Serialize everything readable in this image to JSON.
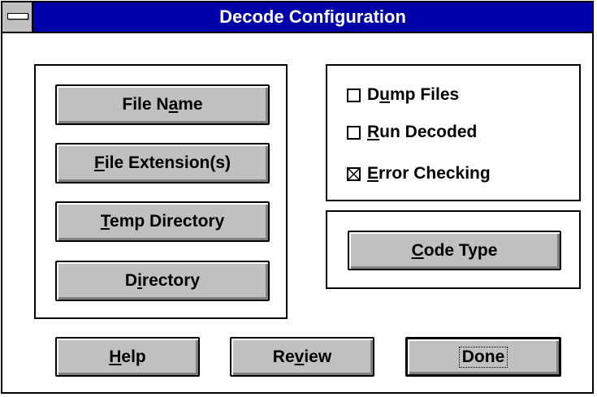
{
  "window": {
    "title": "Decode Configuration",
    "system_menu_icon": "system-menu-bar"
  },
  "file_buttons": {
    "file_name": {
      "pre": "File N",
      "key": "a",
      "post": "me"
    },
    "file_extensions": {
      "pre": "",
      "key": "F",
      "post": "ile Extension(s)"
    },
    "temp_directory": {
      "pre": "",
      "key": "T",
      "post": "emp Directory"
    },
    "directory": {
      "pre": "D",
      "key": "i",
      "post": "rectory"
    }
  },
  "options": {
    "dump_files": {
      "pre": "D",
      "key": "u",
      "post": "mp Files",
      "checked": false
    },
    "run_decoded": {
      "pre": "",
      "key": "R",
      "post": "un Decoded",
      "checked": false
    },
    "error_checking": {
      "pre": "",
      "key": "E",
      "post": "rror Checking",
      "checked": true
    }
  },
  "code_type_button": {
    "pre": "",
    "key": "C",
    "post": "ode Type"
  },
  "footer": {
    "help": {
      "pre": "",
      "key": "H",
      "post": "elp"
    },
    "review": {
      "pre": "Re",
      "key": "v",
      "post": "iew"
    },
    "done": {
      "label": "Done"
    }
  },
  "colors": {
    "title_bar": "#0000a8",
    "button_face": "#c0c0c0",
    "window_bg": "#ffffff"
  }
}
